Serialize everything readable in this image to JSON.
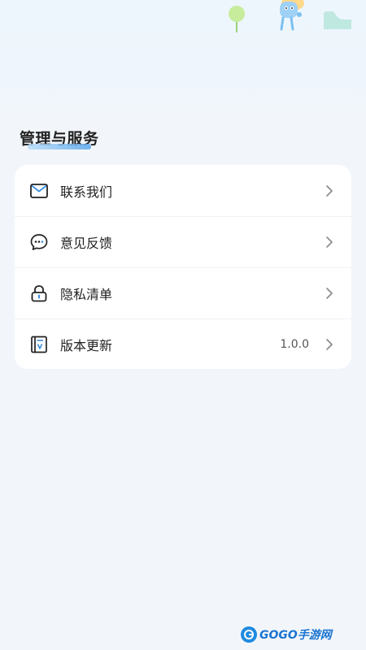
{
  "section": {
    "title": "管理与服务"
  },
  "menu": {
    "items": [
      {
        "label": "联系我们",
        "icon": "mail-icon"
      },
      {
        "label": "意见反馈",
        "icon": "chat-bubble-icon"
      },
      {
        "label": "隐私清单",
        "icon": "lock-icon"
      },
      {
        "label": "版本更新",
        "icon": "version-document-icon",
        "value": "1.0.0"
      }
    ]
  },
  "watermark": {
    "text": "GOGO手游网"
  },
  "colors": {
    "accent": "#3a8fe0",
    "background": "#f2f6fb",
    "card": "#ffffff"
  }
}
